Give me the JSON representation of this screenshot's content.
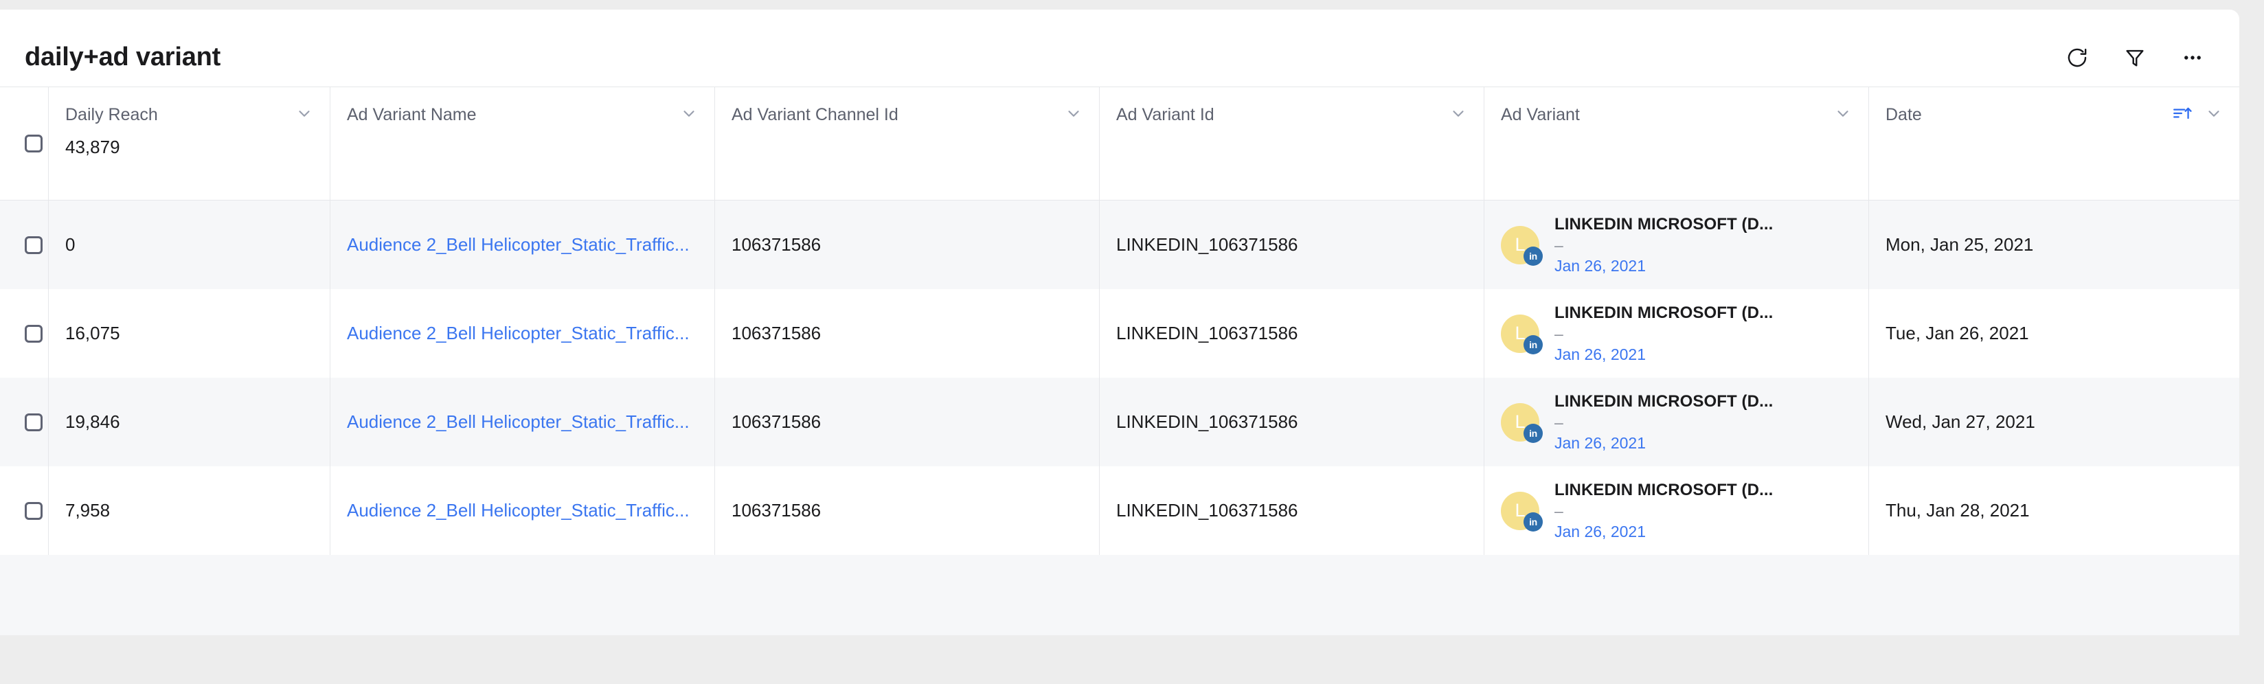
{
  "header": {
    "title": "daily+ad variant",
    "actions": [
      {
        "name": "refresh-button",
        "icon": "refresh-icon",
        "label": "Refresh"
      },
      {
        "name": "filter-button",
        "icon": "filter-icon",
        "label": "Filter"
      },
      {
        "name": "more-options-button",
        "icon": "more-horizontal-icon",
        "label": "More options"
      }
    ]
  },
  "colors": {
    "link": "#3b76f0",
    "accent": "#2f6fad",
    "avatar_bg": "#f5e08c",
    "row_stripe": "#f6f7f9",
    "page_bg": "#ededed",
    "border": "#e6e7ea",
    "header_text": "#5d616e"
  },
  "table": {
    "select_all_label": "Select all rows",
    "columns": [
      {
        "key": "daily_reach",
        "label": "Daily Reach",
        "aggregate": "43,879",
        "has_menu": true,
        "sorted": false
      },
      {
        "key": "ad_variant_name",
        "label": "Ad Variant Name",
        "aggregate": "",
        "has_menu": true,
        "sorted": false
      },
      {
        "key": "ad_variant_channel_id",
        "label": "Ad Variant Channel Id",
        "aggregate": "",
        "has_menu": true,
        "sorted": false
      },
      {
        "key": "ad_variant_id",
        "label": "Ad Variant Id",
        "aggregate": "",
        "has_menu": true,
        "sorted": false
      },
      {
        "key": "ad_variant",
        "label": "Ad Variant",
        "aggregate": "",
        "has_menu": true,
        "sorted": false
      },
      {
        "key": "date",
        "label": "Date",
        "aggregate": "",
        "has_menu": true,
        "sorted": true,
        "sort_direction": "asc"
      }
    ],
    "rows": [
      {
        "daily_reach": "0",
        "ad_variant_name": "Audience 2_Bell Helicopter_Static_Traffic...",
        "ad_variant_channel_id": "106371586",
        "ad_variant_id": "LINKEDIN_106371586",
        "ad_variant": {
          "avatar_initial": "L",
          "channel_badge": "in",
          "title": "LINKEDIN MICROSOFT (D...",
          "subtitle": "–",
          "date": "Jan 26, 2021"
        },
        "date": "Mon, Jan 25, 2021"
      },
      {
        "daily_reach": "16,075",
        "ad_variant_name": "Audience 2_Bell Helicopter_Static_Traffic...",
        "ad_variant_channel_id": "106371586",
        "ad_variant_id": "LINKEDIN_106371586",
        "ad_variant": {
          "avatar_initial": "L",
          "channel_badge": "in",
          "title": "LINKEDIN MICROSOFT (D...",
          "subtitle": "–",
          "date": "Jan 26, 2021"
        },
        "date": "Tue, Jan 26, 2021"
      },
      {
        "daily_reach": "19,846",
        "ad_variant_name": "Audience 2_Bell Helicopter_Static_Traffic...",
        "ad_variant_channel_id": "106371586",
        "ad_variant_id": "LINKEDIN_106371586",
        "ad_variant": {
          "avatar_initial": "L",
          "channel_badge": "in",
          "title": "LINKEDIN MICROSOFT (D...",
          "subtitle": "–",
          "date": "Jan 26, 2021"
        },
        "date": "Wed, Jan 27, 2021"
      },
      {
        "daily_reach": "7,958",
        "ad_variant_name": "Audience 2_Bell Helicopter_Static_Traffic...",
        "ad_variant_channel_id": "106371586",
        "ad_variant_id": "LINKEDIN_106371586",
        "ad_variant": {
          "avatar_initial": "L",
          "channel_badge": "in",
          "title": "LINKEDIN MICROSOFT (D...",
          "subtitle": "–",
          "date": "Jan 26, 2021"
        },
        "date": "Thu, Jan 28, 2021"
      }
    ]
  }
}
